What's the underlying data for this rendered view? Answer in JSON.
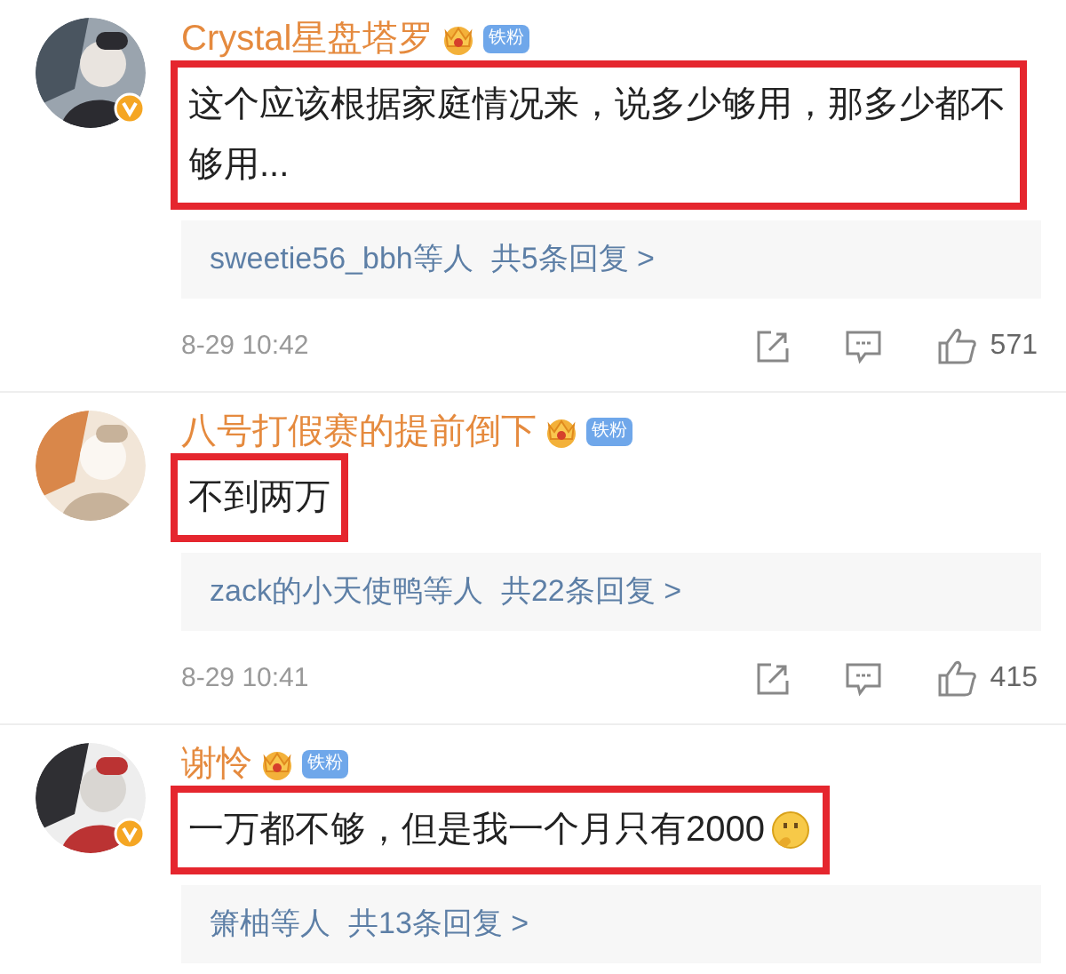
{
  "comments": [
    {
      "avatar": {
        "kind": "picture",
        "verified": true
      },
      "author": "Crystal星盘塔罗",
      "crown": true,
      "badge": "铁粉",
      "text": "这个应该根据家庭情况来，说多少够用，那多少都不够用...",
      "emoji": false,
      "highlighted": true,
      "replies": {
        "users": "sweetie56_bbh等人",
        "count": "共5条回复 >"
      },
      "time": "8-29 10:42",
      "likes": "571"
    },
    {
      "avatar": {
        "kind": "picture",
        "verified": false
      },
      "author": "八号打假赛的提前倒下",
      "crown": true,
      "badge": "铁粉",
      "text": "不到两万",
      "emoji": false,
      "highlighted": true,
      "replies": {
        "users": "zack的小天使鸭等人",
        "count": "共22条回复 >"
      },
      "time": "8-29 10:41",
      "likes": "415"
    },
    {
      "avatar": {
        "kind": "picture",
        "verified": true
      },
      "author": "谢怜",
      "crown": true,
      "badge": "铁粉",
      "text": "一万都不够，但是我一个月只有2000",
      "emoji": true,
      "highlighted": true,
      "replies": {
        "users": "箫柚等人",
        "count": "共13条回复 >"
      }
    }
  ]
}
